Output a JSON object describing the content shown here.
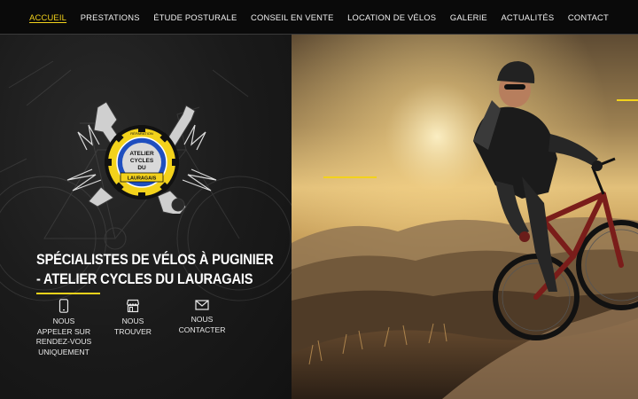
{
  "nav": {
    "items": [
      {
        "label": "ACCUEIL",
        "active": true
      },
      {
        "label": "PRESTATIONS",
        "active": false
      },
      {
        "label": "ÉTUDE POSTURALE",
        "active": false
      },
      {
        "label": "CONSEIL EN VENTE",
        "active": false
      },
      {
        "label": "LOCATION DE VÉLOS",
        "active": false
      },
      {
        "label": "GALERIE",
        "active": false
      },
      {
        "label": "ACTUALITÉS",
        "active": false
      },
      {
        "label": "CONTACT",
        "active": false
      }
    ]
  },
  "hero": {
    "headline_line1": "SPÉCIALISTES DE VÉLOS À PUGINIER",
    "headline_line2": "-  ATELIER CYCLES DU LAURAGAIS",
    "logo": {
      "top_text": "RÉPARATION",
      "center_text_1": "ATELIER",
      "center_text_2": "CYCLES",
      "center_text_3": "DU",
      "banner_text": "LAURAGAIS"
    }
  },
  "contacts": [
    {
      "icon": "phone-icon",
      "line1": "NOUS",
      "line2": "APPELER SUR",
      "line3": "RENDEZ-VOUS",
      "line4": "UNIQUEMENT"
    },
    {
      "icon": "store-icon",
      "line1": "NOUS",
      "line2": "TROUVER"
    },
    {
      "icon": "mail-icon",
      "line1": "NOUS",
      "line2": "CONTACTER"
    }
  ],
  "colors": {
    "accent": "#f3d21b",
    "background": "#1a1a1a",
    "nav_bg": "#0a0a0a"
  }
}
